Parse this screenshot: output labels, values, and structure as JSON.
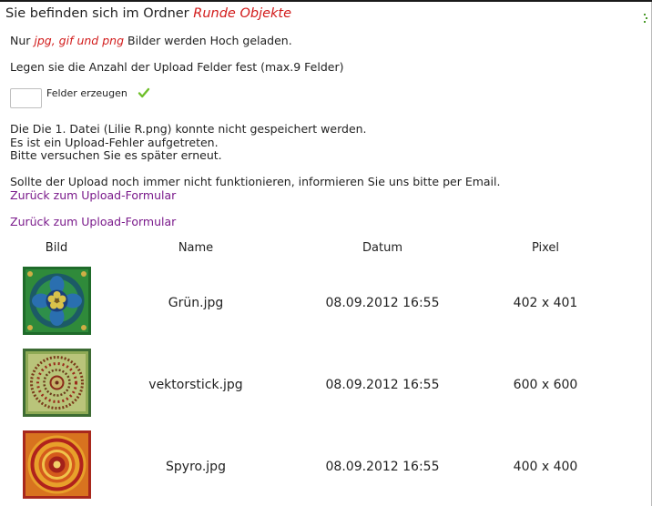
{
  "header": {
    "prefix": "Sie befinden sich im Ordner ",
    "folder": "Runde Objekte"
  },
  "info": {
    "prefix": "Nur ",
    "types": "jpg, gif und png",
    "suffix": " Bilder werden Hoch geladen.",
    "limit_text": "Legen sie die Anzahl der Upload Felder fest (max.9 Felder)"
  },
  "form": {
    "count_value": "",
    "button_label": "Felder erzeugen"
  },
  "error": {
    "line1": "Die Die 1. Datei (Lilie R.png) konnte nicht gespeichert werden.",
    "line2": "Es ist ein Upload-Fehler aufgetreten.",
    "line3": "Bitte versuchen Sie es später erneut.",
    "line4": "Sollte der Upload noch immer nicht funktionieren, informieren Sie uns bitte per Email.",
    "back_link": "Zurück zum Upload-Formular"
  },
  "back_link": "Zurück zum Upload-Formular",
  "table": {
    "headers": [
      "Bild",
      "Name",
      "Datum",
      "Pixel"
    ],
    "rows": [
      {
        "name": "Grün.jpg",
        "date": "08.09.2012 16:55",
        "pixel": "402 x 401"
      },
      {
        "name": "vektorstick.jpg",
        "date": "08.09.2012 16:55",
        "pixel": "600 x 600"
      },
      {
        "name": "Spyro.jpg",
        "date": "08.09.2012 16:55",
        "pixel": "400 x 400"
      }
    ]
  },
  "colors": {
    "accent_red": "#d21b1b",
    "link_purple": "#7a1a8b",
    "check_green": "#6fbf2a"
  },
  "icons": {
    "check": "checkmark-icon"
  }
}
